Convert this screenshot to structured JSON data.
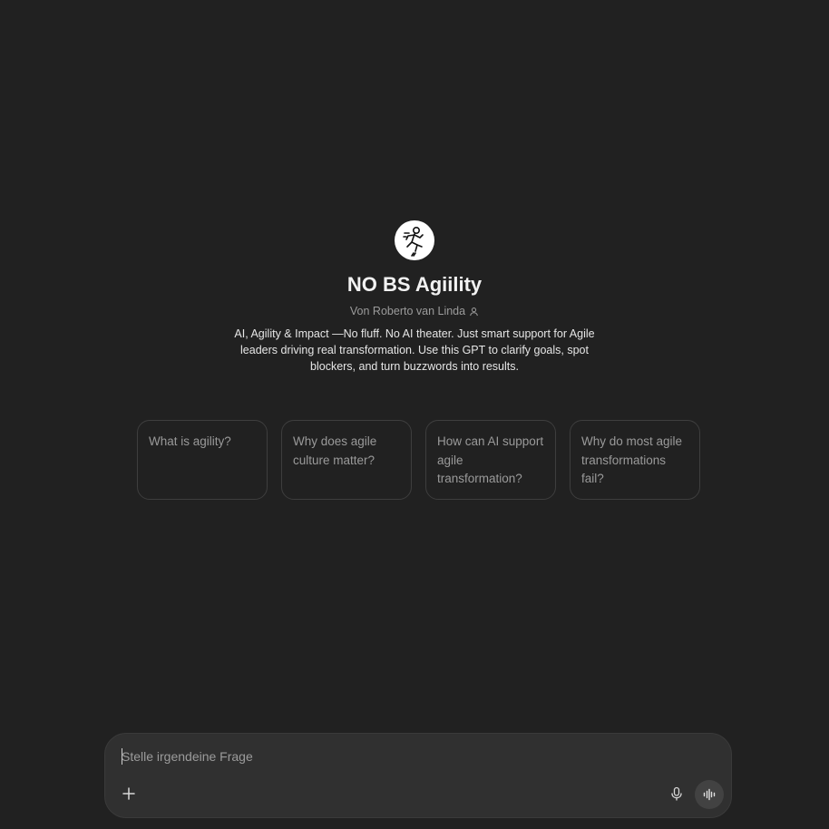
{
  "gpt": {
    "name": "NO BS Agiility",
    "author": "Von Roberto van Linda",
    "description": "AI, Agility & Impact —No fluff. No AI theater. Just smart support for Agile leaders driving real transformation. Use this GPT to clarify goals, spot blockers, and turn buzzwords into results.",
    "avatar_icon": "running-figure-logo"
  },
  "conversation_starters": [
    {
      "label": "What is agility?"
    },
    {
      "label": "Why does agile culture matter?"
    },
    {
      "label": "How can AI support agile transformation?"
    },
    {
      "label": "Why do most agile transformations fail?"
    }
  ],
  "composer": {
    "placeholder": "Stelle irgendeine Frage",
    "value": "",
    "icons": {
      "add": "plus-icon",
      "mic": "microphone-icon",
      "voice": "voice-mode-icon"
    }
  },
  "colors": {
    "background": "#212121",
    "composer": "#303030",
    "border": "#3e3e3e",
    "muted_text": "#9b9b9b"
  }
}
